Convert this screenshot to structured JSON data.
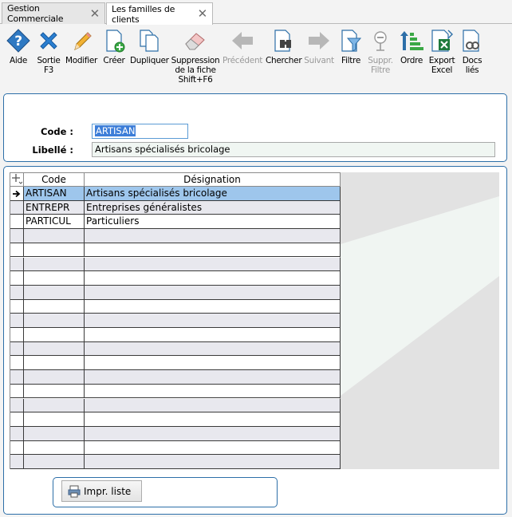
{
  "tabs": [
    {
      "label": "Gestion Commerciale",
      "active": false
    },
    {
      "label": "Les familles de clients",
      "active": true
    }
  ],
  "toolbar": [
    {
      "id": "aide",
      "label": "Aide",
      "icon": "help-icon",
      "disabled": false
    },
    {
      "id": "sortie",
      "label": "Sortie\nF3",
      "icon": "exit-icon",
      "disabled": false
    },
    {
      "id": "modifier",
      "label": "Modifier",
      "icon": "pencil-icon",
      "disabled": false
    },
    {
      "id": "creer",
      "label": "Créer",
      "icon": "new-document-icon",
      "disabled": false
    },
    {
      "id": "dupliquer",
      "label": "Dupliquer",
      "icon": "duplicate-icon",
      "disabled": false
    },
    {
      "id": "suppression",
      "label": "Suppression\nde la fiche\nShift+F6",
      "icon": "eraser-icon",
      "disabled": false
    },
    {
      "id": "precedent",
      "label": "Précédent",
      "icon": "arrow-left-icon",
      "disabled": true
    },
    {
      "id": "chercher",
      "label": "Chercher",
      "icon": "binoculars-icon",
      "disabled": false
    },
    {
      "id": "suivant",
      "label": "Suivant",
      "icon": "arrow-right-icon",
      "disabled": true
    },
    {
      "id": "filtre",
      "label": "Filtre",
      "icon": "filter-icon",
      "disabled": false
    },
    {
      "id": "suppr_filtre",
      "label": "Suppr.\nFiltre",
      "icon": "remove-filter-icon",
      "disabled": true
    },
    {
      "id": "ordre",
      "label": "Ordre",
      "icon": "sort-icon",
      "disabled": false
    },
    {
      "id": "export",
      "label": "Export\nExcel",
      "icon": "excel-icon",
      "disabled": false
    },
    {
      "id": "docs",
      "label": "Docs\nliés",
      "icon": "linked-docs-icon",
      "disabled": false
    }
  ],
  "form": {
    "code_label": "Code :",
    "code_value": "ARTISAN",
    "libelle_label": "Libellé :",
    "libelle_value": "Artisans spécialisés bricolage"
  },
  "grid": {
    "columns": [
      "Code",
      "Désignation"
    ],
    "rows": [
      {
        "code": "ARTISAN",
        "designation": "Artisans spécialisés bricolage",
        "selected": true
      },
      {
        "code": "ENTREPR",
        "designation": "Entreprises généralistes",
        "selected": false
      },
      {
        "code": "PARTICUL",
        "designation": "Particuliers",
        "selected": false
      }
    ],
    "empty_rows": 17
  },
  "print_button": {
    "label": "Impr. liste",
    "icon": "printer-icon"
  },
  "colors": {
    "accent": "#2d6fa8",
    "selection": "#9ec6ec",
    "code_highlight": "#3d7ed8"
  }
}
